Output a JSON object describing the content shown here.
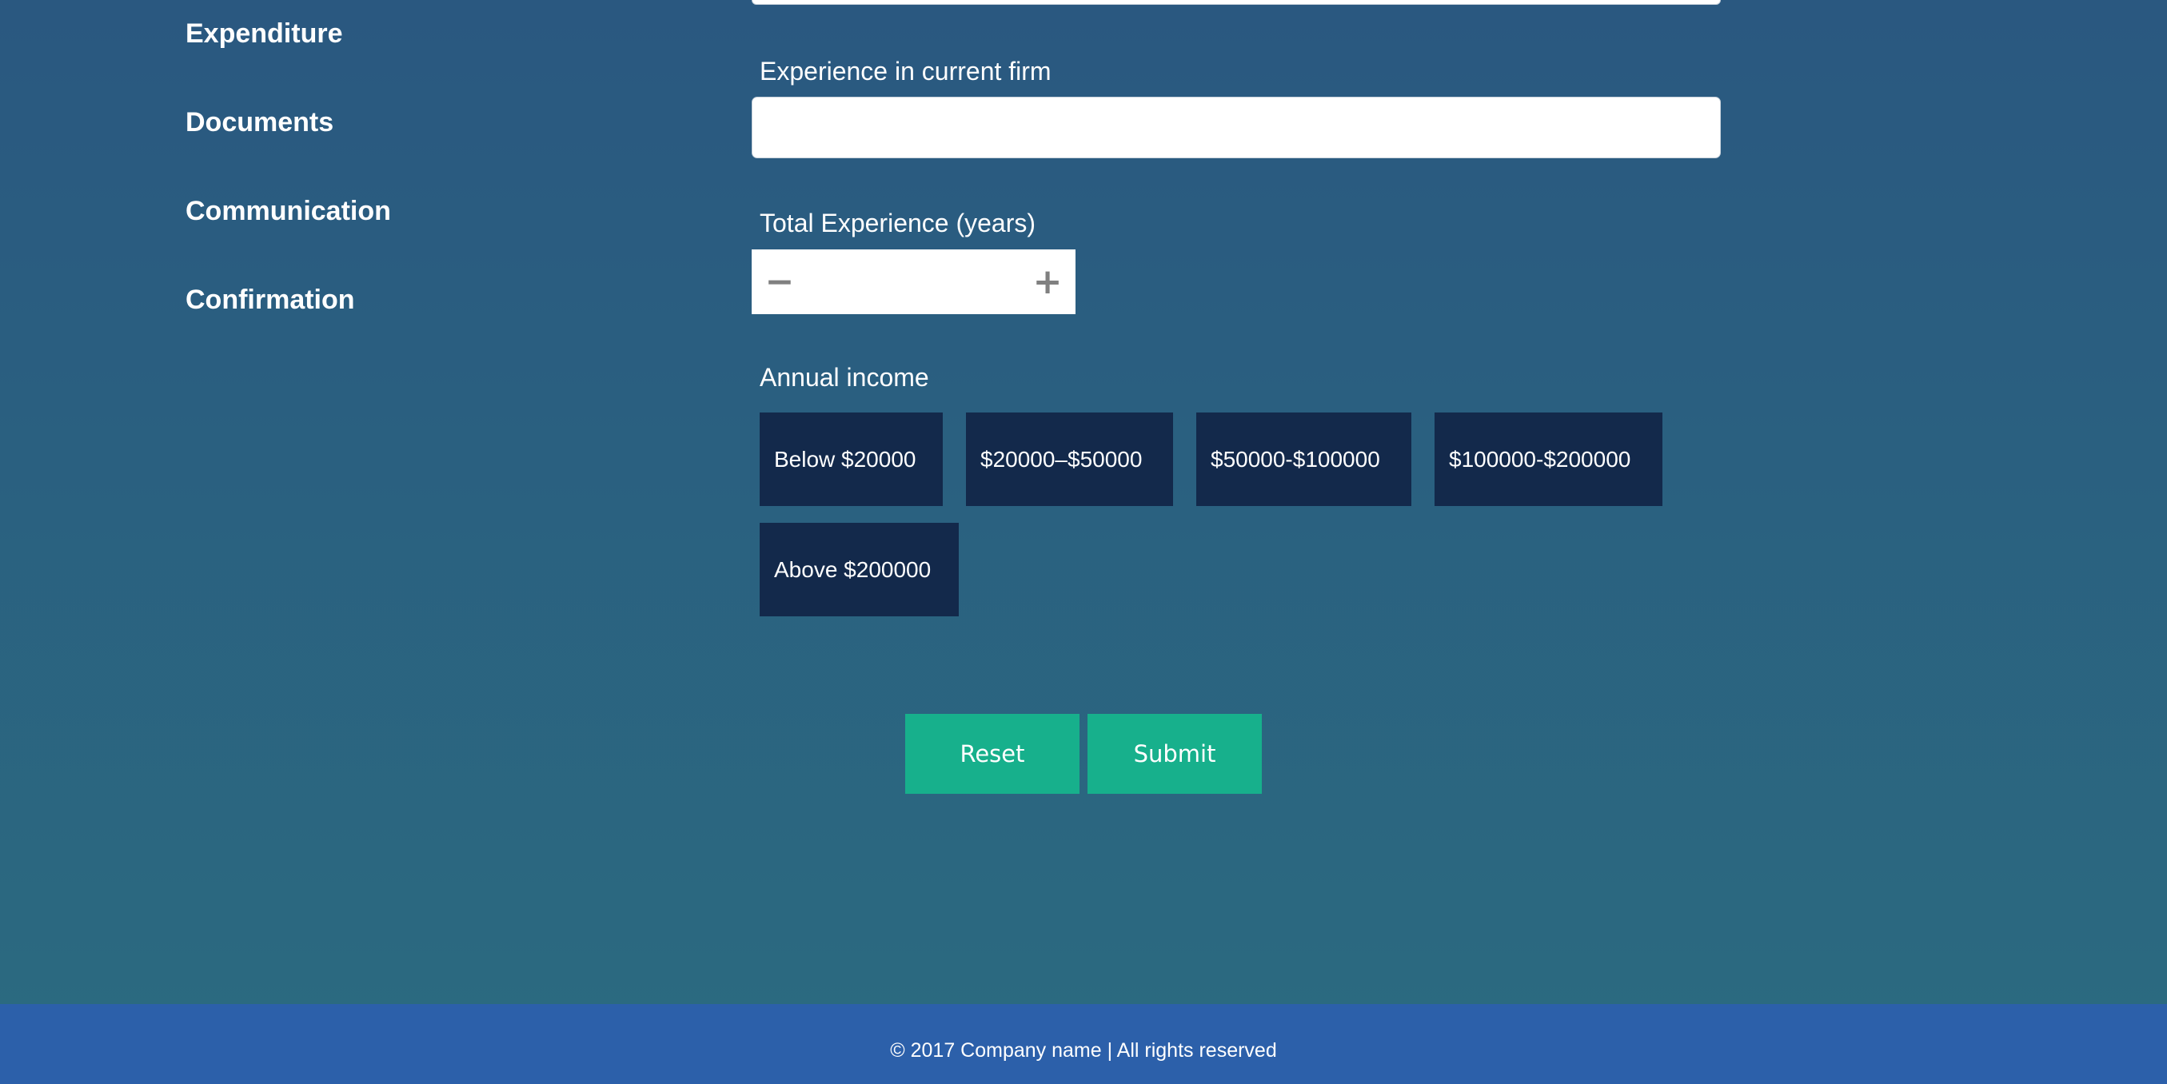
{
  "sidebar": {
    "steps": [
      {
        "label": "Expenditure"
      },
      {
        "label": "Documents"
      },
      {
        "label": "Communication"
      },
      {
        "label": "Confirmation"
      }
    ]
  },
  "form": {
    "experience_current_firm": {
      "label": "Experience in current firm",
      "value": ""
    },
    "total_experience": {
      "label": "Total Experience (years)",
      "value": "",
      "decrement_symbol": "−",
      "increment_symbol": "+"
    },
    "annual_income": {
      "label": "Annual income",
      "options": [
        {
          "label": "Below $20000"
        },
        {
          "label": "$20000–$50000"
        },
        {
          "label": "$50000-$100000"
        },
        {
          "label": "$100000-$200000"
        },
        {
          "label": "Above $200000"
        }
      ]
    },
    "reset_label": "Reset",
    "submit_label": "Submit"
  },
  "footer": {
    "text": "© 2017 Company name | All rights reserved"
  },
  "colors": {
    "background_top": "#2a5880",
    "background_bottom": "#2b6b80",
    "option_bg": "#13294b",
    "action_bg": "#17b08c",
    "footer_bg": "#2c60aa"
  }
}
